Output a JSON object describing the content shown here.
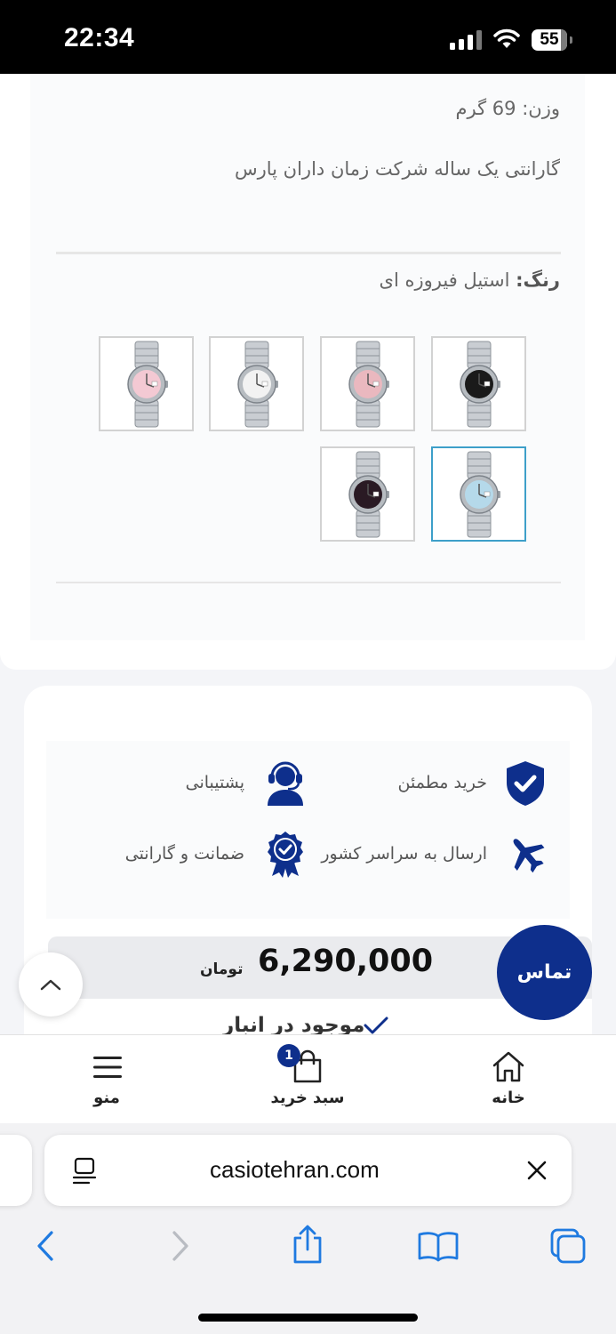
{
  "status_bar": {
    "time": "22:34",
    "battery": "55"
  },
  "product": {
    "weight": "وزن: 69 گرم",
    "warranty": "گارانتی یک ساله شرکت زمان داران پارس",
    "color_label": "رنگ:",
    "color_value": "استیل فیروزه ای",
    "swatches": [
      {
        "name": "black",
        "dial": "#1a1a1a",
        "selected": false
      },
      {
        "name": "pink",
        "dial": "#eab8bf",
        "selected": false
      },
      {
        "name": "white",
        "dial": "#f2f2f2",
        "selected": false
      },
      {
        "name": "light-pink",
        "dial": "#f3c9d3",
        "selected": false
      },
      {
        "name": "turquoise",
        "dial": "#b5d9ea",
        "selected": true
      },
      {
        "name": "dark-red",
        "dial": "#2a1a24",
        "selected": false
      }
    ]
  },
  "features": {
    "secure_purchase": "خرید مطمئن",
    "support": "پشتیبانی",
    "shipping": "ارسال به سراسر کشور",
    "guarantee": "ضمانت و گارانتی"
  },
  "price": {
    "value": "6,290,000",
    "unit": "تومان"
  },
  "stock": {
    "label": "موجود در انبار"
  },
  "contact_label": "تماس",
  "bottom_nav": {
    "menu": "منو",
    "cart": "سبد خرید",
    "home": "خانه",
    "cart_count": "1"
  },
  "browser": {
    "url": "casiotehran.com"
  },
  "colors": {
    "brand": "#0e2f8c",
    "selected_border": "#3d9fc9",
    "ios_blue": "#1f7ae0"
  }
}
